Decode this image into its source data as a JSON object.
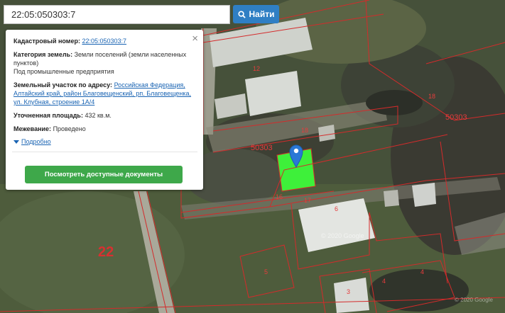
{
  "search": {
    "value": "22:05:050303:7",
    "button_label": "Найти"
  },
  "popup": {
    "cadastral_label": "Кадастровый номер:",
    "cadastral_value": "22:05:050303:7",
    "category_label": "Категория земель:",
    "category_value": "Земли поселений (земли населенных пунктов)",
    "category_note": "Под промышленные предприятия",
    "address_label": "Земельный участок по адресу:",
    "address_value": "Российская Федерация, Алтайский край, район Благовещенский, рп. Благовещенка, ул. Клубная, строение 1А/4",
    "area_label": "Уточненная площадь:",
    "area_value": "432 кв.м.",
    "survey_label": "Межевание:",
    "survey_value": "Проведено",
    "details_link": "Подробно",
    "docs_button": "Посмотреть доступные документы",
    "close": "×"
  },
  "map_labels": {
    "block_a": "50303",
    "block_b": "50303",
    "district": "22",
    "parcel_12": "12",
    "parcel_18a": "18",
    "parcel_18b": "18",
    "parcel_16": "16",
    "parcel_17": "17",
    "parcel_6": "6",
    "parcel_5": "5",
    "parcel_4a": "4",
    "parcel_4b": "4",
    "parcel_3": "3"
  },
  "watermarks": {
    "w1": "© 2020 Google",
    "w2": "© 2020 Google"
  },
  "colors": {
    "parcel_fill": "#3ef03a",
    "boundary": "#d42b2b",
    "marker": "#2a78d6",
    "button_blue": "#2f7fc4",
    "button_green": "#3ea84a"
  }
}
